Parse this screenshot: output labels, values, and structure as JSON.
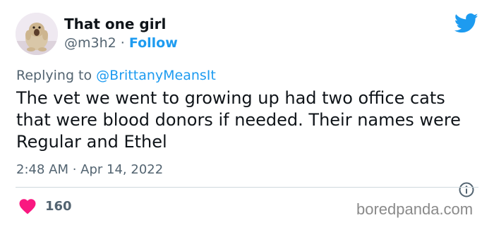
{
  "tweet": {
    "author": {
      "display_name": "That one girl",
      "handle": "@m3h2",
      "separator": "·",
      "follow_label": "Follow"
    },
    "reply": {
      "prefix": "Replying to",
      "handle": "@BrittanyMeansIt"
    },
    "text": "The vet we went to growing up had two office cats that were blood donors if needed. Their names were Regular and Ethel",
    "timestamp": "2:48 AM · Apr 14, 2022",
    "likes": "160"
  },
  "watermark": "boredpanda.com",
  "colors": {
    "accent": "#1d9bf0",
    "heart": "#f91880",
    "secondary_text": "#536471"
  },
  "icons": {
    "brand": "twitter-bird-icon",
    "info": "info-icon",
    "like": "heart-icon"
  }
}
